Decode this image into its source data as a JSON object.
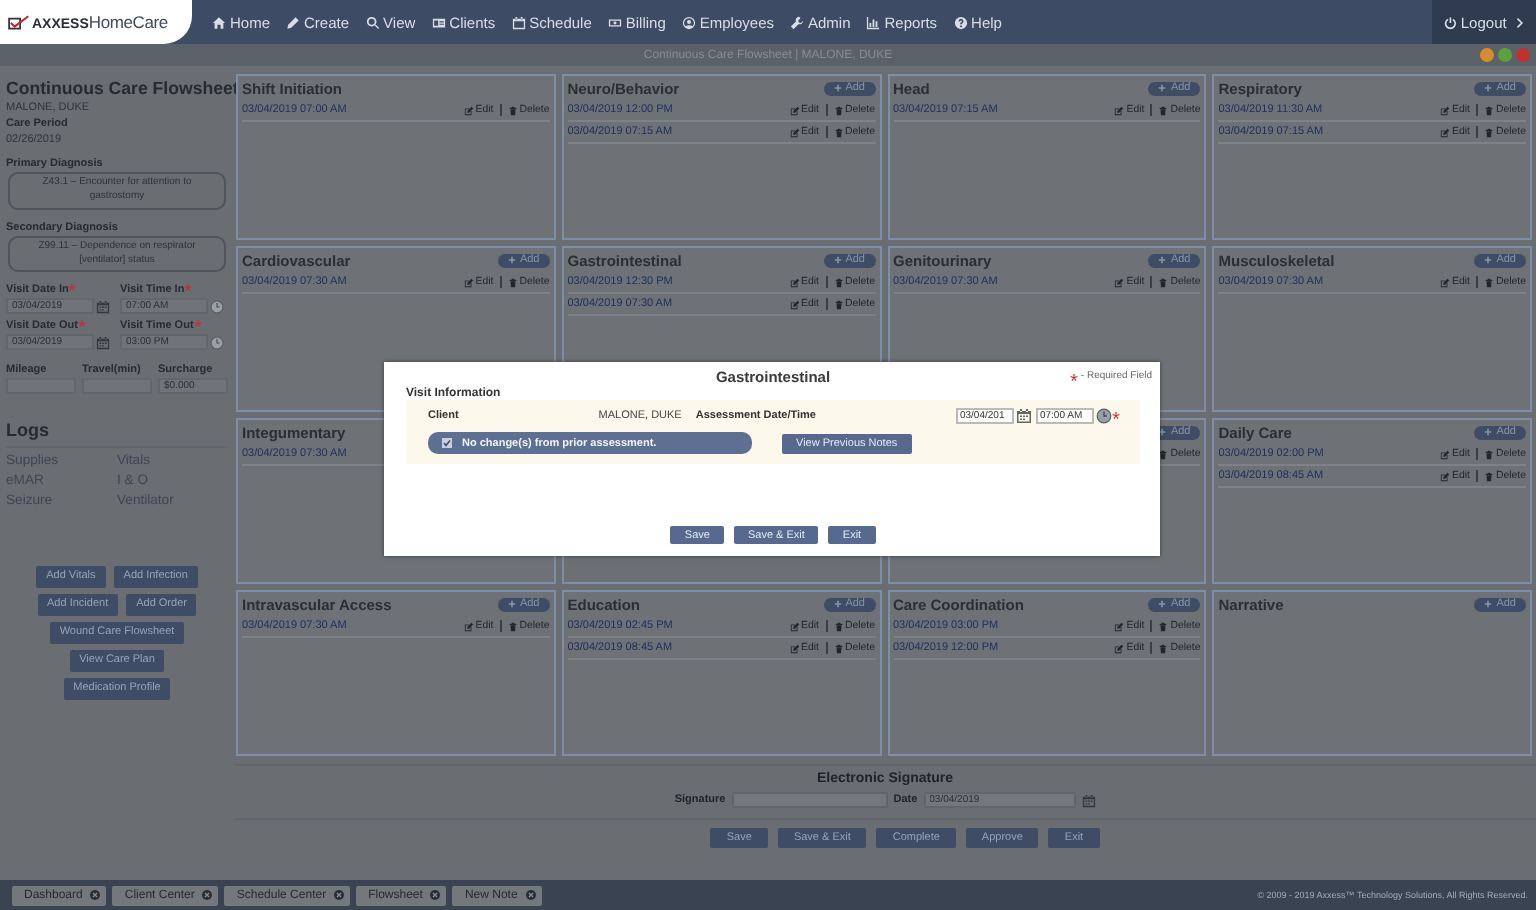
{
  "nav": {
    "logo_bold": "AXXESS",
    "logo_light": "HomeCare",
    "items": [
      {
        "label": "Home"
      },
      {
        "label": "Create"
      },
      {
        "label": "View"
      },
      {
        "label": "Clients"
      },
      {
        "label": "Schedule"
      },
      {
        "label": "Billing"
      },
      {
        "label": "Employees"
      },
      {
        "label": "Admin"
      },
      {
        "label": "Reports"
      },
      {
        "label": "Help"
      }
    ],
    "logout": "Logout"
  },
  "title_bar": {
    "title": "Continuous Care Flowsheet | MALONE, DUKE"
  },
  "sidebar": {
    "title": "Continuous Care Flowsheet",
    "patient": "MALONE, DUKE",
    "care_period_label": "Care Period",
    "care_period": "02/26/2019",
    "diagnoses": [
      {
        "label": "Primary Diagnosis",
        "value": "Z43.1 – Encounter for attention to gastrostomy"
      },
      {
        "label": "Secondary Diagnosis",
        "value": "Z99.11 – Dependence on respirator [ventilator] status"
      }
    ],
    "visit_fields": [
      {
        "label": "Visit Date In",
        "required": true,
        "value": "03/04/2019",
        "kind": "date"
      },
      {
        "label": "Visit Time In",
        "required": true,
        "value": "07:00 AM",
        "kind": "time"
      },
      {
        "label": "Visit Date Out",
        "required": true,
        "value": "03/04/2019",
        "kind": "date"
      },
      {
        "label": "Visit Time Out",
        "required": true,
        "value": "03:00 PM",
        "kind": "time"
      }
    ],
    "trip_fields": [
      {
        "label": "Mileage"
      },
      {
        "label": "Travel(min)"
      },
      {
        "label": "Surcharge",
        "value": "$0.000"
      }
    ],
    "logs_title": "Logs",
    "logs": [
      "Supplies",
      "Vitals",
      "eMAR",
      "I & O",
      "Seizure",
      "Ventilator"
    ],
    "actions": [
      [
        "Add Vitals",
        "Add Infection"
      ],
      [
        "Add Incident",
        "Add Order"
      ],
      [
        "Wound Care Flowsheet"
      ],
      [
        "View Care Plan"
      ],
      [
        "Medication Profile"
      ]
    ]
  },
  "sections": [
    {
      "kind": "card",
      "title": "Shift Initiation",
      "entries": [
        {
          "date": "03/04/2019 07:00 AM",
          "edit": "Edit",
          "delete": "Delete"
        }
      ]
    },
    {
      "kind": "card",
      "title": "Neuro/Behavior",
      "add": "Add",
      "entries": [
        {
          "date": "03/04/2019 12:00 PM",
          "edit": "Edit",
          "delete": "Delete"
        },
        {
          "date": "03/04/2019 07:15 AM",
          "edit": "Edit",
          "delete": "Delete"
        }
      ]
    },
    {
      "kind": "card",
      "title": "Head",
      "add": "Add",
      "entries": [
        {
          "date": "03/04/2019 07:15 AM",
          "edit": "Edit",
          "delete": "Delete"
        }
      ]
    },
    {
      "kind": "card",
      "title": "Respiratory",
      "add": "Add",
      "entries": [
        {
          "date": "03/04/2019 11:30 AM",
          "edit": "Edit",
          "delete": "Delete"
        },
        {
          "date": "03/04/2019 07:15 AM",
          "edit": "Edit",
          "delete": "Delete"
        }
      ]
    },
    {
      "kind": "card",
      "title": "Cardiovascular",
      "add": "Add",
      "entries": [
        {
          "date": "03/04/2019 07:30 AM",
          "edit": "Edit",
          "delete": "Delete"
        }
      ]
    },
    {
      "kind": "card",
      "title": "Gastrointestinal",
      "add": "Add",
      "entries": [
        {
          "date": "03/04/2019 12:30 PM",
          "edit": "Edit",
          "delete": "Delete"
        },
        {
          "date": "03/04/2019 07:30 AM",
          "edit": "Edit",
          "delete": "Delete"
        }
      ]
    },
    {
      "kind": "card",
      "title": "Genitourinary",
      "add": "Add",
      "entries": [
        {
          "date": "03/04/2019 07:30 AM",
          "edit": "Edit",
          "delete": "Delete"
        }
      ]
    },
    {
      "kind": "card",
      "title": "Musculoskeletal",
      "add": "Add",
      "entries": [
        {
          "date": "03/04/2019 07:30 AM",
          "edit": "Edit",
          "delete": "Delete"
        }
      ]
    },
    {
      "kind": "card",
      "title": "Integumentary",
      "entries": [
        {
          "date": "03/04/2019 07:30 AM"
        }
      ]
    },
    {
      "kind": "empty"
    },
    {
      "kind": "card",
      "add": "Add",
      "entries": [
        {
          "delete": "Delete"
        }
      ]
    },
    {
      "kind": "card",
      "title": "Daily Care",
      "add": "Add",
      "entries": [
        {
          "date": "03/04/2019 02:00 PM",
          "edit": "Edit",
          "delete": "Delete"
        },
        {
          "date": "03/04/2019 08:45 AM",
          "edit": "Edit",
          "delete": "Delete"
        }
      ]
    },
    {
      "kind": "card",
      "title": "Intravascular Access",
      "add": "Add",
      "entries": [
        {
          "date": "03/04/2019 07:30 AM",
          "edit": "Edit",
          "delete": "Delete"
        }
      ]
    },
    {
      "kind": "card",
      "title": "Education",
      "add": "Add",
      "entries": [
        {
          "date": "03/04/2019 02:45 PM",
          "edit": "Edit",
          "delete": "Delete"
        },
        {
          "date": "03/04/2019 08:45 AM",
          "edit": "Edit",
          "delete": "Delete"
        }
      ]
    },
    {
      "kind": "card",
      "title": "Care Coordination",
      "add": "Add",
      "entries": [
        {
          "date": "03/04/2019 03:00 PM",
          "edit": "Edit",
          "delete": "Delete"
        },
        {
          "date": "03/04/2019 12:00 PM",
          "edit": "Edit",
          "delete": "Delete"
        }
      ]
    },
    {
      "kind": "card",
      "title": "Narrative",
      "add": "Add"
    }
  ],
  "signature": {
    "title": "Electronic Signature",
    "signature_label": "Signature",
    "date_label": "Date",
    "date": "03/04/2019"
  },
  "buttons": [
    "Save",
    "Save & Exit",
    "Complete",
    "Approve",
    "Exit"
  ],
  "taskbar": {
    "tabs": [
      "Dashboard",
      "Client Center",
      "Schedule Center",
      "Flowsheet",
      "New Note"
    ],
    "copyright": "© 2009 - 2019 Axxess™ Technology Solutions, All Rights Reserved."
  },
  "modal": {
    "title": "Gastrointestinal",
    "required_note": "- Required Field",
    "section": "Visit Information",
    "client_label": "Client",
    "client": "MALONE, DUKE",
    "assessment_label": "Assessment Date/Time",
    "date": "03/04/201",
    "time": "07:00 AM",
    "required": true,
    "no_change": {
      "label": "No change(s) from prior assessment.",
      "checked": true
    },
    "view_previous": "View Previous Notes",
    "buttons": [
      "Save",
      "Save & Exit",
      "Exit"
    ]
  }
}
